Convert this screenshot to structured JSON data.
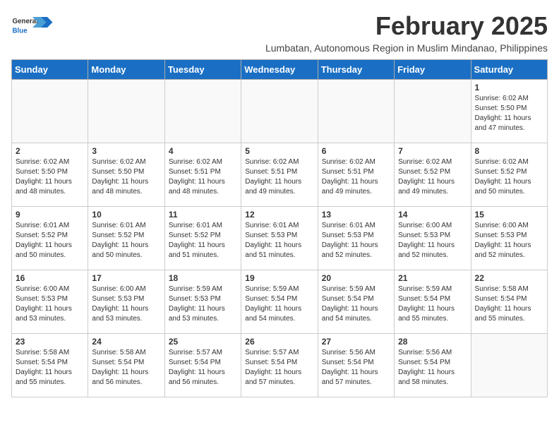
{
  "header": {
    "logo_general": "General",
    "logo_blue": "Blue",
    "month": "February 2025",
    "location": "Lumbatan, Autonomous Region in Muslim Mindanao, Philippines"
  },
  "days_of_week": [
    "Sunday",
    "Monday",
    "Tuesday",
    "Wednesday",
    "Thursday",
    "Friday",
    "Saturday"
  ],
  "weeks": [
    [
      {
        "day": "",
        "info": ""
      },
      {
        "day": "",
        "info": ""
      },
      {
        "day": "",
        "info": ""
      },
      {
        "day": "",
        "info": ""
      },
      {
        "day": "",
        "info": ""
      },
      {
        "day": "",
        "info": ""
      },
      {
        "day": "1",
        "info": "Sunrise: 6:02 AM\nSunset: 5:50 PM\nDaylight: 11 hours\nand 47 minutes."
      }
    ],
    [
      {
        "day": "2",
        "info": "Sunrise: 6:02 AM\nSunset: 5:50 PM\nDaylight: 11 hours\nand 48 minutes."
      },
      {
        "day": "3",
        "info": "Sunrise: 6:02 AM\nSunset: 5:50 PM\nDaylight: 11 hours\nand 48 minutes."
      },
      {
        "day": "4",
        "info": "Sunrise: 6:02 AM\nSunset: 5:51 PM\nDaylight: 11 hours\nand 48 minutes."
      },
      {
        "day": "5",
        "info": "Sunrise: 6:02 AM\nSunset: 5:51 PM\nDaylight: 11 hours\nand 49 minutes."
      },
      {
        "day": "6",
        "info": "Sunrise: 6:02 AM\nSunset: 5:51 PM\nDaylight: 11 hours\nand 49 minutes."
      },
      {
        "day": "7",
        "info": "Sunrise: 6:02 AM\nSunset: 5:52 PM\nDaylight: 11 hours\nand 49 minutes."
      },
      {
        "day": "8",
        "info": "Sunrise: 6:02 AM\nSunset: 5:52 PM\nDaylight: 11 hours\nand 50 minutes."
      }
    ],
    [
      {
        "day": "9",
        "info": "Sunrise: 6:01 AM\nSunset: 5:52 PM\nDaylight: 11 hours\nand 50 minutes."
      },
      {
        "day": "10",
        "info": "Sunrise: 6:01 AM\nSunset: 5:52 PM\nDaylight: 11 hours\nand 50 minutes."
      },
      {
        "day": "11",
        "info": "Sunrise: 6:01 AM\nSunset: 5:52 PM\nDaylight: 11 hours\nand 51 minutes."
      },
      {
        "day": "12",
        "info": "Sunrise: 6:01 AM\nSunset: 5:53 PM\nDaylight: 11 hours\nand 51 minutes."
      },
      {
        "day": "13",
        "info": "Sunrise: 6:01 AM\nSunset: 5:53 PM\nDaylight: 11 hours\nand 52 minutes."
      },
      {
        "day": "14",
        "info": "Sunrise: 6:00 AM\nSunset: 5:53 PM\nDaylight: 11 hours\nand 52 minutes."
      },
      {
        "day": "15",
        "info": "Sunrise: 6:00 AM\nSunset: 5:53 PM\nDaylight: 11 hours\nand 52 minutes."
      }
    ],
    [
      {
        "day": "16",
        "info": "Sunrise: 6:00 AM\nSunset: 5:53 PM\nDaylight: 11 hours\nand 53 minutes."
      },
      {
        "day": "17",
        "info": "Sunrise: 6:00 AM\nSunset: 5:53 PM\nDaylight: 11 hours\nand 53 minutes."
      },
      {
        "day": "18",
        "info": "Sunrise: 5:59 AM\nSunset: 5:53 PM\nDaylight: 11 hours\nand 53 minutes."
      },
      {
        "day": "19",
        "info": "Sunrise: 5:59 AM\nSunset: 5:54 PM\nDaylight: 11 hours\nand 54 minutes."
      },
      {
        "day": "20",
        "info": "Sunrise: 5:59 AM\nSunset: 5:54 PM\nDaylight: 11 hours\nand 54 minutes."
      },
      {
        "day": "21",
        "info": "Sunrise: 5:59 AM\nSunset: 5:54 PM\nDaylight: 11 hours\nand 55 minutes."
      },
      {
        "day": "22",
        "info": "Sunrise: 5:58 AM\nSunset: 5:54 PM\nDaylight: 11 hours\nand 55 minutes."
      }
    ],
    [
      {
        "day": "23",
        "info": "Sunrise: 5:58 AM\nSunset: 5:54 PM\nDaylight: 11 hours\nand 55 minutes."
      },
      {
        "day": "24",
        "info": "Sunrise: 5:58 AM\nSunset: 5:54 PM\nDaylight: 11 hours\nand 56 minutes."
      },
      {
        "day": "25",
        "info": "Sunrise: 5:57 AM\nSunset: 5:54 PM\nDaylight: 11 hours\nand 56 minutes."
      },
      {
        "day": "26",
        "info": "Sunrise: 5:57 AM\nSunset: 5:54 PM\nDaylight: 11 hours\nand 57 minutes."
      },
      {
        "day": "27",
        "info": "Sunrise: 5:56 AM\nSunset: 5:54 PM\nDaylight: 11 hours\nand 57 minutes."
      },
      {
        "day": "28",
        "info": "Sunrise: 5:56 AM\nSunset: 5:54 PM\nDaylight: 11 hours\nand 58 minutes."
      },
      {
        "day": "",
        "info": ""
      }
    ]
  ]
}
